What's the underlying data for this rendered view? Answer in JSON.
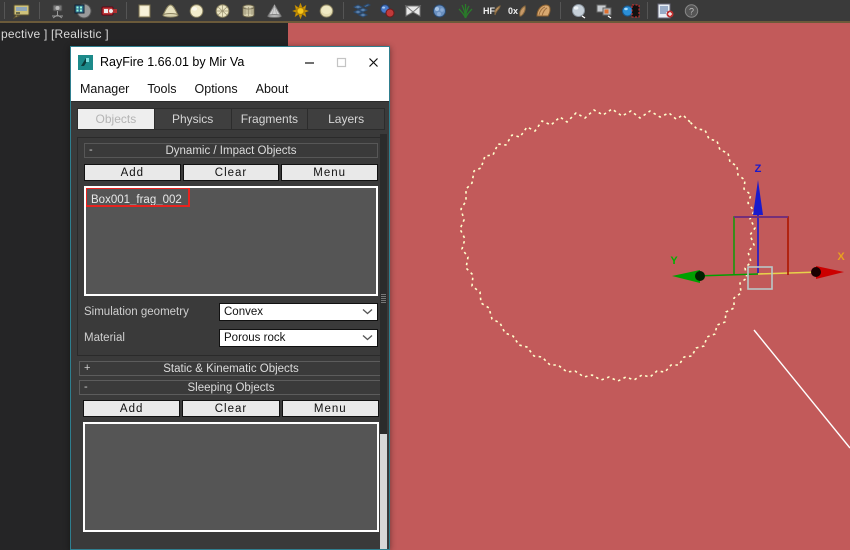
{
  "viewport": {
    "label": "pective ] [Realistic ]",
    "gizmo": {
      "axis_x_label": "X",
      "axis_y_label": "Y",
      "axis_z_label": "Z",
      "color_x": "#cc0000",
      "color_y": "#00a000",
      "color_z": "#1a1acc"
    },
    "bg_color": "#c25a5a",
    "dark_bg_color": "#252526",
    "selection_outline_color": "#ffffcc"
  },
  "toolbar": {
    "icons": [
      "render-setup-icon",
      "render-frame-window-icon",
      "render-production-icon",
      "render-iterative-icon",
      "box-icon",
      "cone-icon",
      "sphere-icon",
      "geosphere-icon",
      "cylinder-icon",
      "tube-icon",
      "torus-icon",
      "pyramid-icon",
      "teapot-icon",
      "plane-icon",
      "particle-icon",
      "sphere-gizmo-icon",
      "cloth-icon",
      "hair-fur-icon",
      "ox-icon",
      "fur-icon",
      "material-sphere-icon",
      "material-editor-icon",
      "light-blue-sphere-icon",
      "render-to-texture-icon",
      "help-icon"
    ]
  },
  "window": {
    "title": "RayFire 1.66.01  by Mir Va",
    "app_icon": "rayfire-icon",
    "buttons": {
      "minimize": "minimize-button",
      "maximize": "maximize-button",
      "close": "close-button"
    },
    "menu": [
      "Manager",
      "Tools",
      "Options",
      "About"
    ],
    "tabs": [
      {
        "label": "Objects",
        "active": true
      },
      {
        "label": "Physics",
        "active": false
      },
      {
        "label": "Fragments",
        "active": false
      },
      {
        "label": "Layers",
        "active": false
      }
    ],
    "sections": {
      "dynamic": {
        "expander": "-",
        "title": "Dynamic / Impact Objects",
        "buttons": [
          "Add",
          "Clear",
          "Menu"
        ],
        "list_items": [
          "Box001_frag_002"
        ],
        "highlight_color": "#e8231f",
        "fields": [
          {
            "label": "Simulation geometry",
            "value": "Convex"
          },
          {
            "label": "Material",
            "value": "Porous rock"
          }
        ]
      },
      "static": {
        "expander": "+",
        "title": "Static & Kinematic Objects"
      },
      "sleeping": {
        "expander": "-",
        "title": "Sleeping Objects",
        "buttons": [
          "Add",
          "Clear",
          "Menu"
        ],
        "list_items": []
      }
    }
  }
}
